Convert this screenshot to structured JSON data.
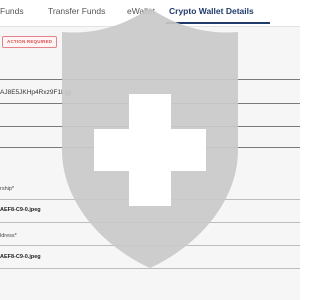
{
  "tabs": [
    {
      "label": "Funds",
      "active": false
    },
    {
      "label": "Transfer Funds",
      "active": false
    },
    {
      "label": "eWallet",
      "active": false
    },
    {
      "label": "Crypto Wallet Details",
      "active": true
    }
  ],
  "badge": {
    "label": "ACTION REQUIRED"
  },
  "wallet": {
    "address_value": "AJ8E5JKHp4Rxz9F1Lgy"
  },
  "uploads": [
    {
      "label": "rship*",
      "file_name": "AEF8-C9-0.jpeg"
    },
    {
      "label": "ldress*",
      "file_name": "AEF8-C9-0.jpeg"
    }
  ],
  "overlay": {
    "icon": "shield-plus-icon",
    "shield_color": "#c9c9c9",
    "cross_color": "#ffffff"
  },
  "colors": {
    "accent": "#1f3a6b",
    "badge_text": "#d9534f",
    "badge_border": "#e5828a"
  }
}
